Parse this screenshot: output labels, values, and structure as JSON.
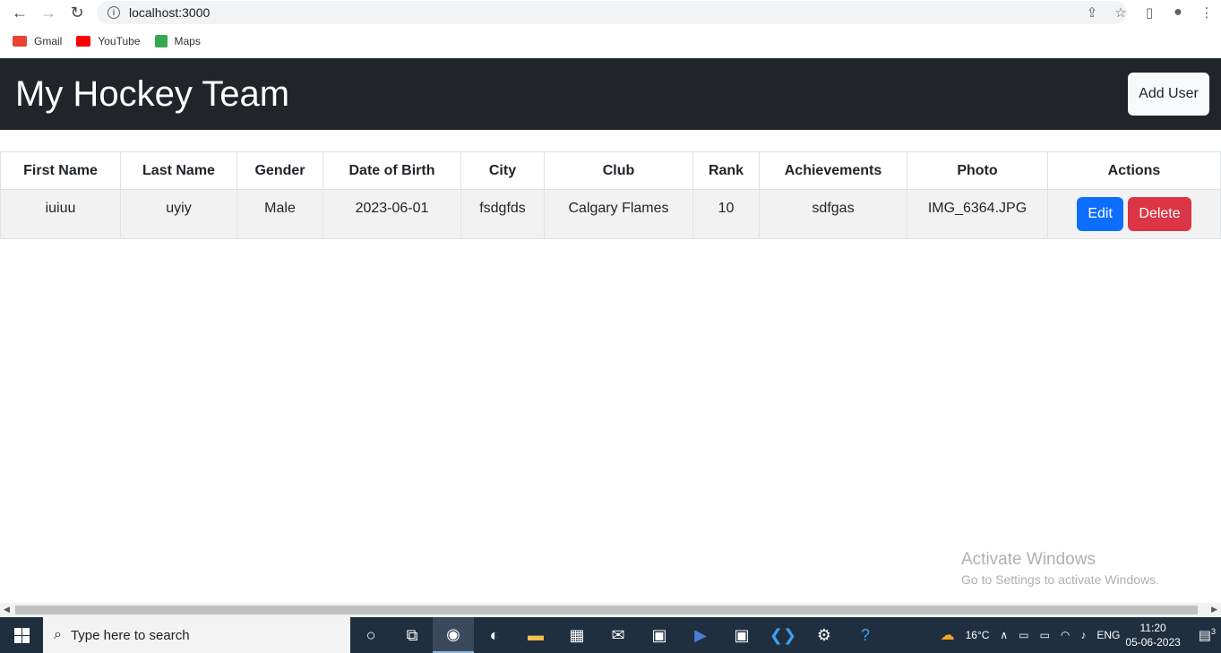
{
  "browser": {
    "url": "localhost:3000",
    "bookmarks": [
      {
        "label": "Gmail",
        "color": "#ea4335"
      },
      {
        "label": "YouTube",
        "color": "#ff0000"
      },
      {
        "label": "Maps",
        "color": "#34a853"
      }
    ]
  },
  "navbar": {
    "brand": "My Hockey Team",
    "add_user_label": "Add User",
    "bg_color": "#212529"
  },
  "table": {
    "headers": [
      "First Name",
      "Last Name",
      "Gender",
      "Date of Birth",
      "City",
      "Club",
      "Rank",
      "Achievements",
      "Photo",
      "Actions"
    ],
    "rows": [
      {
        "first_name": "iuiuu",
        "last_name": "uyiy",
        "gender": "Male",
        "dob": "2023-06-01",
        "city": "fsdgfds",
        "club": "Calgary Flames",
        "rank": "10",
        "achievements": "sdfgas",
        "photo": "IMG_6364.JPG",
        "edit_label": "Edit",
        "delete_label": "Delete"
      }
    ]
  },
  "watermark": {
    "line1": "Activate Windows",
    "line2": "Go to Settings to activate Windows."
  },
  "taskbar": {
    "search_placeholder": "Type here to search",
    "weather": "16°C",
    "language": "ENG",
    "time": "11:20",
    "date": "05-06-2023",
    "notification_count": "3"
  },
  "colors": {
    "edit": "#0d6efd",
    "delete": "#dc3545"
  }
}
